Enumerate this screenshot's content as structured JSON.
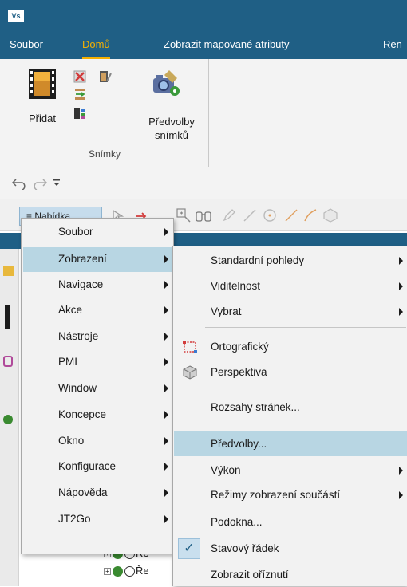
{
  "app": {
    "icon_text": "Vs"
  },
  "ribbon_tabs": [
    "Soubor",
    "Domů",
    "Zobrazit mapované atributy",
    "Ren"
  ],
  "ribbon": {
    "add_label": "Přidat",
    "prefs_label_line1": "Předvolby",
    "prefs_label_line2": "snímků",
    "group_label": "Snímky"
  },
  "quick_access": {
    "undo_icon": "undo-icon",
    "redo_icon": "redo-icon",
    "customize_icon": "customize-qat-icon"
  },
  "toolbar": {
    "menu_button_label": "≡ Nabídka"
  },
  "main_menu": {
    "items": [
      {
        "label": "Soubor",
        "has_submenu": true
      },
      {
        "label": "Zobrazení",
        "has_submenu": true,
        "highlighted": true
      },
      {
        "label": "Navigace",
        "has_submenu": true
      },
      {
        "label": "Akce",
        "has_submenu": true
      },
      {
        "label": "Nástroje",
        "has_submenu": true
      },
      {
        "label": "PMI",
        "has_submenu": true
      },
      {
        "label": "Window",
        "has_submenu": true
      },
      {
        "label": "Koncepce",
        "has_submenu": true
      },
      {
        "label": "Okno",
        "has_submenu": true
      },
      {
        "label": "Konfigurace",
        "has_submenu": true
      },
      {
        "label": "Nápověda",
        "has_submenu": true
      },
      {
        "label": "JT2Go",
        "has_submenu": true
      }
    ]
  },
  "view_submenu": {
    "items": [
      {
        "label": "Standardní pohledy",
        "has_submenu": true
      },
      {
        "label": "Viditelnost",
        "has_submenu": true
      },
      {
        "label": "Vybrat",
        "has_submenu": true
      },
      {
        "label": "Ortografický",
        "icon": "orthographic-icon"
      },
      {
        "label": "Perspektiva",
        "icon": "perspective-icon"
      },
      {
        "label": "Rozsahy stránek..."
      },
      {
        "label": "Předvolby...",
        "highlighted": true
      },
      {
        "label": "Výkon",
        "has_submenu": true
      },
      {
        "label": "Režimy zobrazení součástí",
        "has_submenu": true
      },
      {
        "label": "Podokna..."
      },
      {
        "label": "Stavový řádek",
        "checked": true
      },
      {
        "label": "Zobrazit oříznutí"
      }
    ]
  },
  "tree_fragments": [
    "Ře",
    "Ře"
  ],
  "colors": {
    "title_bar": "#1f5f85",
    "active_tab": "#f5b000",
    "highlight": "#b8d6e3"
  }
}
